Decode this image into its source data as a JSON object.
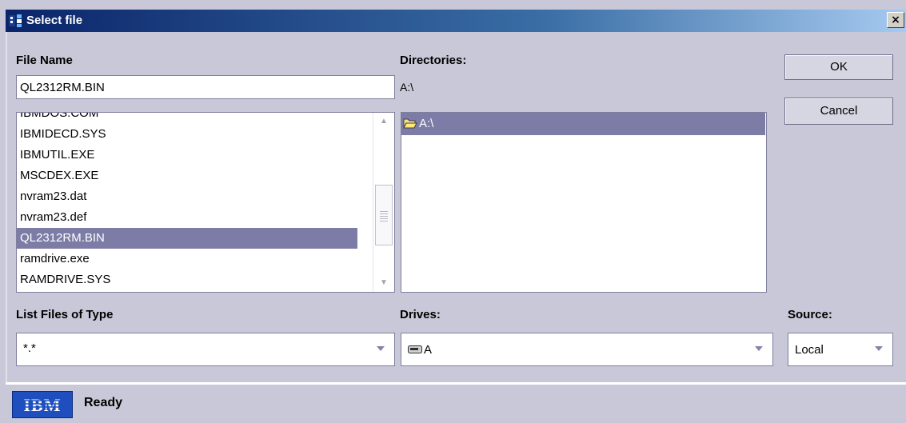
{
  "window": {
    "title": "Select file",
    "close_label": "×"
  },
  "file_name": {
    "label": "File Name",
    "value": "QL2312RM.BIN"
  },
  "files": {
    "partial_top": "IBMDOS.COM",
    "items": [
      "IBMIDECD.SYS",
      "IBMUTIL.EXE",
      "MSCDEX.EXE",
      "nvram23.dat",
      "nvram23.def",
      "QL2312RM.BIN",
      "ramdrive.exe",
      "RAMDRIVE.SYS"
    ],
    "selected": "QL2312RM.BIN"
  },
  "directories": {
    "label": "Directories:",
    "current_path": "A:\\",
    "items": [
      "A:\\"
    ]
  },
  "buttons": {
    "ok": "OK",
    "cancel": "Cancel"
  },
  "file_type": {
    "label": "List Files of Type",
    "value": "*.*"
  },
  "drives": {
    "label": "Drives:",
    "value": "A"
  },
  "source": {
    "label": "Source:",
    "value": "Local"
  },
  "status": {
    "logo_text": "IBM",
    "text": "Ready"
  },
  "icons": {
    "app": "java-app-icon",
    "folder": "open-folder-icon",
    "drive": "floppy-drive-icon"
  },
  "colors": {
    "selection": "#7c7ca6",
    "dialog_bg": "#c8c8d8",
    "title_start": "#0a246a",
    "ibm_blue": "#1f4fbf"
  }
}
